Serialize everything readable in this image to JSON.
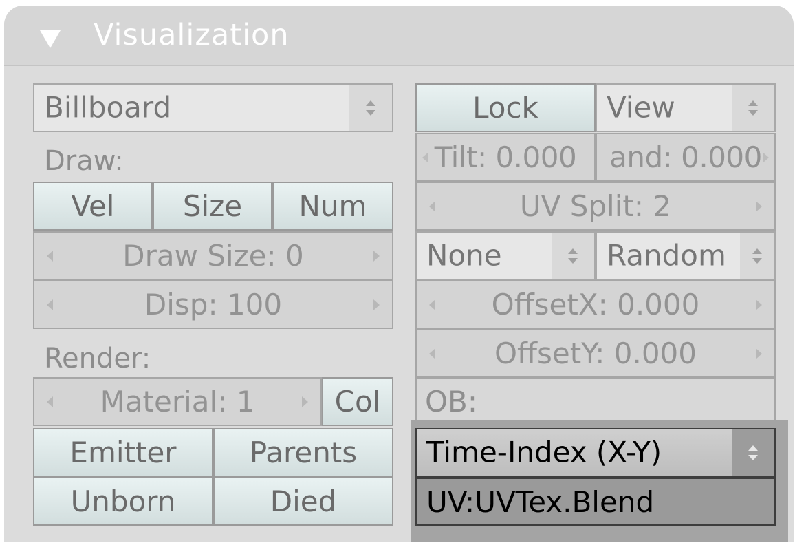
{
  "panel": {
    "title": "Visualization"
  },
  "left": {
    "billboard_menu": "Billboard",
    "draw_label": "Draw:",
    "vel_button": "Vel",
    "size_button": "Size",
    "num_button": "Num",
    "draw_size_field": "Draw Size: 0",
    "disp_field": "Disp: 100",
    "render_label": "Render:",
    "material_field": "Material: 1",
    "col_button": "Col",
    "emitter_button": "Emitter",
    "parents_button": "Parents",
    "unborn_button": "Unborn",
    "died_button": "Died"
  },
  "right": {
    "lock_button": "Lock",
    "view_menu": "View",
    "tilt_field": "Tilt: 0.000",
    "and_field": "and: 0.000",
    "uv_split_field": "UV Split: 2",
    "none_menu": "None",
    "random_menu": "Random",
    "offsetx_field": "OffsetX: 0.000",
    "offsety_field": "OffsetY: 0.000",
    "ob_label": "OB:",
    "time_index_menu": "Time-Index (X-Y)",
    "uv_field": "UV:UVTex.Blend"
  }
}
